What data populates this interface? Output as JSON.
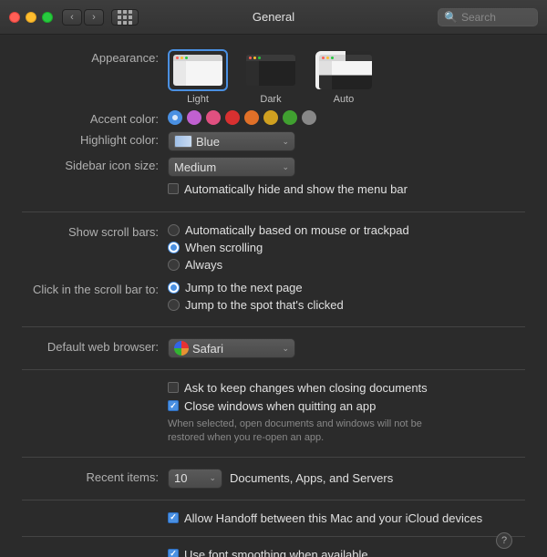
{
  "window": {
    "title": "General",
    "search_placeholder": "Search"
  },
  "appearance": {
    "label": "Appearance:",
    "options": [
      {
        "id": "light",
        "label": "Light",
        "selected": true
      },
      {
        "id": "dark",
        "label": "Dark",
        "selected": false
      },
      {
        "id": "auto",
        "label": "Auto",
        "selected": false
      }
    ]
  },
  "accent_color": {
    "label": "Accent color:",
    "colors": [
      {
        "id": "blue",
        "hex": "#4a90e2",
        "selected": true
      },
      {
        "id": "purple",
        "hex": "#c060d0"
      },
      {
        "id": "pink",
        "hex": "#e05080"
      },
      {
        "id": "red",
        "hex": "#d83030"
      },
      {
        "id": "orange",
        "hex": "#e07028"
      },
      {
        "id": "yellow",
        "hex": "#d0a020"
      },
      {
        "id": "green",
        "hex": "#40a030"
      },
      {
        "id": "graphite",
        "hex": "#888888"
      }
    ]
  },
  "highlight_color": {
    "label": "Highlight color:",
    "value": "Blue"
  },
  "sidebar_icon_size": {
    "label": "Sidebar icon size:",
    "value": "Medium"
  },
  "menu_bar": {
    "label": "",
    "option": "Automatically hide and show the menu bar",
    "checked": false
  },
  "show_scroll_bars": {
    "label": "Show scroll bars:",
    "options": [
      {
        "id": "auto",
        "label": "Automatically based on mouse or trackpad",
        "selected": false
      },
      {
        "id": "scrolling",
        "label": "When scrolling",
        "selected": true
      },
      {
        "id": "always",
        "label": "Always",
        "selected": false
      }
    ]
  },
  "click_scroll_bar": {
    "label": "Click in the scroll bar to:",
    "options": [
      {
        "id": "next-page",
        "label": "Jump to the next page",
        "selected": true
      },
      {
        "id": "clicked-spot",
        "label": "Jump to the spot that's clicked",
        "selected": false
      }
    ]
  },
  "default_browser": {
    "label": "Default web browser:",
    "value": "Safari"
  },
  "documents": {
    "ask_keep_changes": {
      "label": "Ask to keep changes when closing documents",
      "checked": false
    },
    "close_windows": {
      "label": "Close windows when quitting an app",
      "checked": true
    },
    "note": "When selected, open documents and windows will not be restored when you re-open an app."
  },
  "recent_items": {
    "label": "Recent items:",
    "value": "10",
    "suffix": "Documents, Apps, and Servers"
  },
  "handoff": {
    "label": "Allow Handoff between this Mac and your iCloud devices",
    "checked": true
  },
  "font_smoothing": {
    "label": "Use font smoothing when available",
    "checked": true
  },
  "help": "?"
}
